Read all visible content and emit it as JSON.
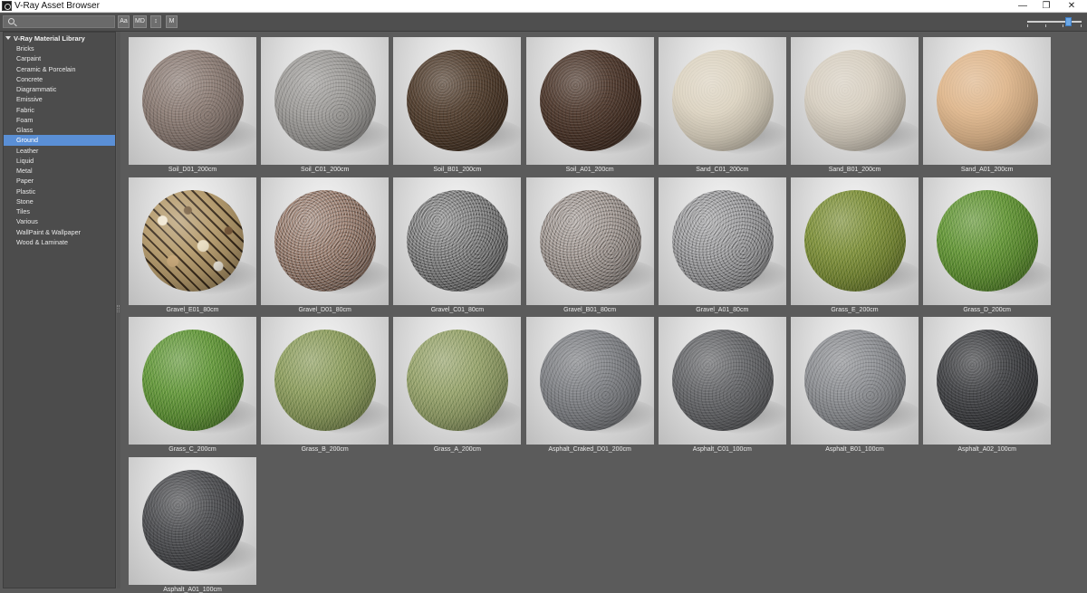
{
  "window": {
    "title": "V-Ray Asset Browser",
    "minimize": "—",
    "maximize": "❐",
    "close": "✕"
  },
  "toolbar": {
    "search_value": "",
    "buttons": [
      "Aa",
      "MD",
      "↕",
      "M"
    ],
    "zoom_level": 0.8
  },
  "sidebar": {
    "root": "V-Ray Material Library",
    "items": [
      "Bricks",
      "Carpaint",
      "Ceramic & Porcelain",
      "Concrete",
      "Diagrammatic",
      "Emissive",
      "Fabric",
      "Foam",
      "Glass",
      "Ground",
      "Leather",
      "Liquid",
      "Metal",
      "Paper",
      "Plastic",
      "Stone",
      "Tiles",
      "Various",
      "WallPaint & Wallpaper",
      "Wood & Laminate"
    ],
    "selected": "Ground"
  },
  "materials": [
    {
      "name": "Soil_D01_200cm",
      "color": "#8a7a72",
      "texture": "fine"
    },
    {
      "name": "Soil_C01_200cm",
      "color": "#9c9a97",
      "texture": "fine"
    },
    {
      "name": "Soil_B01_200cm",
      "color": "#4e3a2a",
      "texture": "fine"
    },
    {
      "name": "Soil_A01_200cm",
      "color": "#4a3428",
      "texture": "fine"
    },
    {
      "name": "Sand_C01_200cm",
      "color": "#ddd4c2",
      "texture": "smooth"
    },
    {
      "name": "Sand_B01_200cm",
      "color": "#d8d0c2",
      "texture": "smooth"
    },
    {
      "name": "Sand_A01_200cm",
      "color": "#e0b88e",
      "texture": "smooth"
    },
    {
      "name": "Gravel_E01_80cm",
      "color": "#b49a6c",
      "texture": "pebbles"
    },
    {
      "name": "Gravel_D01_80cm",
      "color": "#8c6e5e",
      "texture": "gravel"
    },
    {
      "name": "Gravel_C01_80cm",
      "color": "#6e6e6e",
      "texture": "gravel"
    },
    {
      "name": "Gravel_B01_80cm",
      "color": "#948a84",
      "texture": "gravel"
    },
    {
      "name": "Gravel_A01_80cm",
      "color": "#8e8e90",
      "texture": "gravel"
    },
    {
      "name": "Grass_E_200cm",
      "color": "#7a8c36",
      "texture": "grass"
    },
    {
      "name": "Grass_D_200cm",
      "color": "#5e9232",
      "texture": "grass"
    },
    {
      "name": "Grass_C_200cm",
      "color": "#5e9436",
      "texture": "grass"
    },
    {
      "name": "Grass_B_200cm",
      "color": "#8a9a5c",
      "texture": "grass"
    },
    {
      "name": "Grass_A_200cm",
      "color": "#94a06a",
      "texture": "grass"
    },
    {
      "name": "Asphalt_Craked_D01_200cm",
      "color": "#7e8084",
      "texture": "fine"
    },
    {
      "name": "Asphalt_C01_100cm",
      "color": "#646568",
      "texture": "fine"
    },
    {
      "name": "Asphalt_B01_100cm",
      "color": "#8c8e92",
      "texture": "fine"
    },
    {
      "name": "Asphalt_A02_100cm",
      "color": "#3e3f42",
      "texture": "fine"
    },
    {
      "name": "Asphalt_A01_100cm",
      "color": "#4a4b4e",
      "texture": "fine"
    }
  ]
}
